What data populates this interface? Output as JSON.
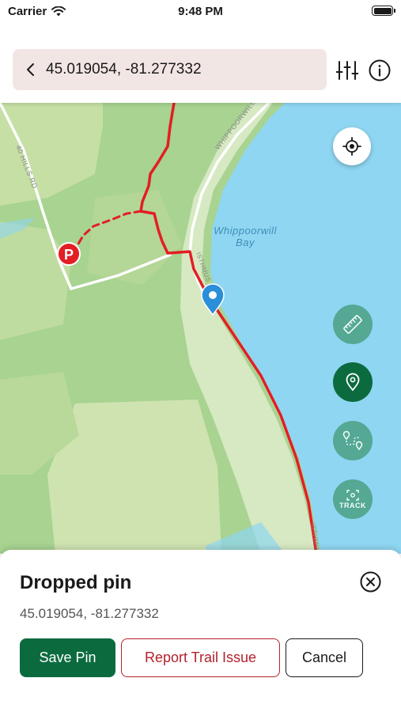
{
  "status_bar": {
    "carrier": "Carrier",
    "time": "9:48 PM"
  },
  "search": {
    "value": "45.019054, -81.277332"
  },
  "icons": {
    "back": "chevron-left-icon",
    "filter": "sliders-icon",
    "info": "info-icon",
    "locate": "crosshair-icon",
    "measure": "ruler-icon",
    "pin": "map-pin-icon",
    "route": "route-icon",
    "track": "track-icon",
    "close": "close-circle-icon"
  },
  "map": {
    "labels": {
      "road_40_hills": "40 HILLS RD",
      "road_whippoorwill": "WHIPPOORWILL R",
      "bay_line1": "Whippoorwill",
      "bay_line2": "Bay",
      "road_isthmus_top": "ISTHMUS",
      "road_isthmus_bottom": "ISTHMU"
    },
    "parking_letter": "P",
    "track_label": "TRACK"
  },
  "sheet": {
    "title": "Dropped pin",
    "coords": "45.019054, -81.277332",
    "save_label": "Save Pin",
    "report_label": "Report Trail Issue",
    "cancel_label": "Cancel"
  },
  "colors": {
    "primary_green": "#0b6b3f",
    "light_green_fab": "#4fa58d",
    "trail_red": "#e31e24",
    "report_red": "#b3212b",
    "water_blue": "#8fd6f2",
    "pin_blue": "#2a8fd8",
    "search_bg": "#f2e6e5"
  }
}
